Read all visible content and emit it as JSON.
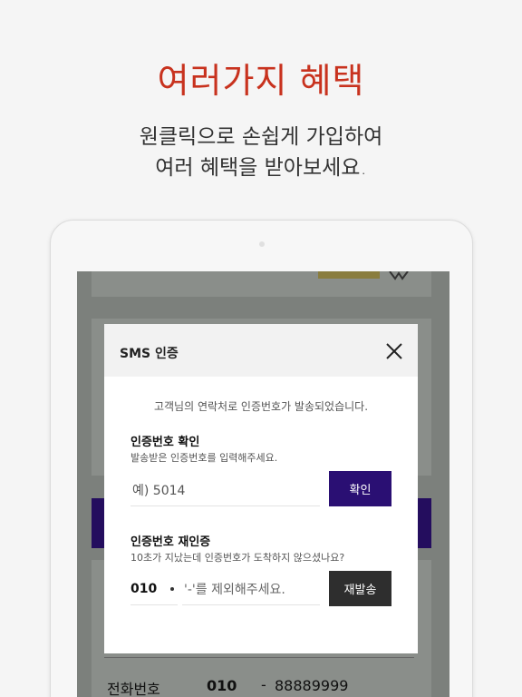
{
  "promo": {
    "title": "여러가지 혜택",
    "subtitle_line1": "원클릭으로 손쉽게 가입하여",
    "subtitle_line2": "여러 혜택을 받아보세요."
  },
  "background": {
    "phone_label": "전화번호",
    "phone_prefix": "010",
    "phone_separator": "-",
    "phone_number": "88889999"
  },
  "modal": {
    "title": "SMS 인증",
    "close_icon": "close-icon",
    "notice": "고객님의 연락처로 인증번호가 발송되었습니다.",
    "verify": {
      "title": "인증번호 확인",
      "description": "발송받은 인증번호를 입력해주세요.",
      "placeholder": "예) 5014",
      "button_label": "확인"
    },
    "resend": {
      "title": "인증번호 재인증",
      "description": "10초가 지났는데 인증번호가 도착하지 않으셨나요?",
      "prefix": "010",
      "placeholder": "'-'를 제외해주세요.",
      "button_label": "재발송"
    }
  },
  "colors": {
    "accent_red": "#c8321e",
    "brand_purple": "#2a0f73",
    "dark_button": "#2e2e2e",
    "overlay": "#7c807c"
  }
}
